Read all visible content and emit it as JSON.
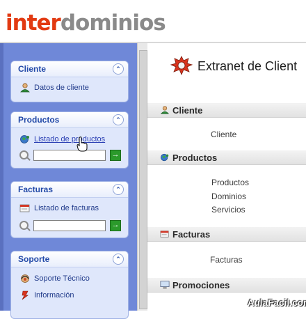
{
  "header": {
    "logo_part1": "inter",
    "logo_part2": "dominios"
  },
  "sidebar": {
    "cliente": {
      "title": "Cliente",
      "items": [
        {
          "label": "Datos de cliente",
          "icon": "user-icon"
        }
      ]
    },
    "productos": {
      "title": "Productos",
      "items": [
        {
          "label": "Listado de productos",
          "icon": "globe-icon"
        }
      ],
      "search_value": ""
    },
    "facturas": {
      "title": "Facturas",
      "items": [
        {
          "label": "Listado de facturas",
          "icon": "invoice-icon"
        }
      ],
      "search_value": ""
    },
    "soporte": {
      "title": "Soporte",
      "items": [
        {
          "label": "Soporte Técnico",
          "icon": "support-icon"
        },
        {
          "label": "Información",
          "icon": "info-icon"
        }
      ]
    }
  },
  "main": {
    "title": "Extranet de Client",
    "sections": [
      {
        "title": "Cliente",
        "icon": "user-icon",
        "links": [
          "Cliente"
        ]
      },
      {
        "title": "Productos",
        "icon": "globe-icon",
        "links": [
          "Productos",
          "Dominios",
          "Servicios"
        ]
      },
      {
        "title": "Facturas",
        "icon": "invoice-icon",
        "links": [
          "Facturas"
        ]
      },
      {
        "title": "Promociones",
        "icon": "monitor-icon",
        "links": []
      }
    ]
  },
  "watermark": "AulaFacil.com",
  "colors": {
    "sidebar_bg": "#6f88d8",
    "panel_title": "#234aa8",
    "logo_accent": "#e23a12",
    "logo_gray": "#8a8a8a"
  }
}
